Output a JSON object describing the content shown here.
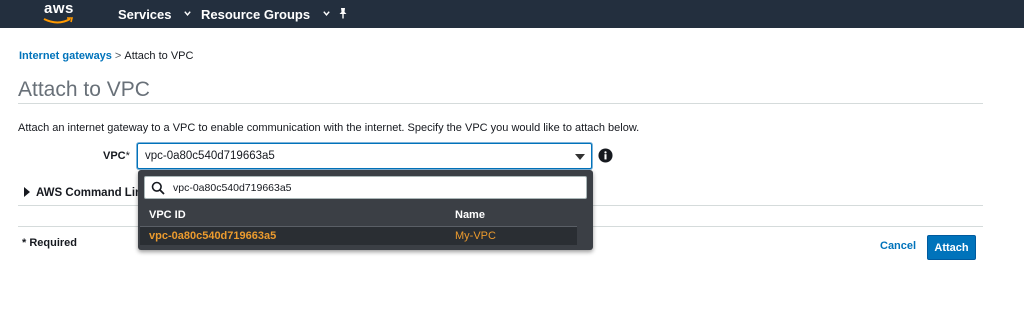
{
  "nav": {
    "logo": "aws",
    "services": "Services",
    "resource_groups": "Resource Groups"
  },
  "breadcrumb": {
    "parent": "Internet gateways",
    "separator": ">",
    "current": "Attach to VPC"
  },
  "page": {
    "title": "Attach to VPC",
    "description": "Attach an internet gateway to a VPC to enable communication with the internet. Specify the VPC you would like to attach below."
  },
  "form": {
    "vpc_label": "VPC",
    "vpc_required_mark": "*",
    "vpc_selected": "vpc-0a80c540d719663a5",
    "cli_section": "AWS Command Line",
    "required_note": "* Required"
  },
  "dropdown": {
    "search_value": "vpc-0a80c540d719663a5",
    "columns": [
      "VPC ID",
      "Name"
    ],
    "rows": [
      {
        "vpc_id": "vpc-0a80c540d719663a5",
        "name": "My-VPC"
      }
    ]
  },
  "actions": {
    "cancel": "Cancel",
    "attach": "Attach"
  },
  "colors": {
    "nav_bg": "#232f3e",
    "link": "#0073bb",
    "primary_button": "#0073bb",
    "dropdown_bg": "#3b3f45",
    "highlight": "#ec9b2e"
  }
}
